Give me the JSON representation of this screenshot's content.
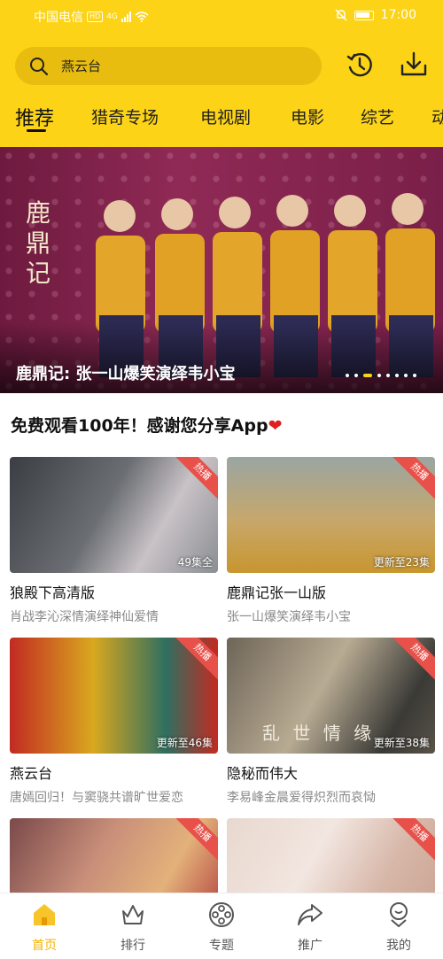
{
  "status_bar": {
    "carrier": "中国电信",
    "network_badge": "HD",
    "network_type": "4G",
    "time": "17:00"
  },
  "search": {
    "value": "燕云台",
    "icon": "search-icon"
  },
  "header_actions": [
    {
      "icon": "history-icon"
    },
    {
      "icon": "download-icon"
    }
  ],
  "tabs": [
    {
      "label": "推荐",
      "active": true
    },
    {
      "label": "猎奇专场"
    },
    {
      "label": "电视剧"
    },
    {
      "label": "电影"
    },
    {
      "label": "综艺"
    },
    {
      "label": "动"
    }
  ],
  "banner": {
    "title": "鹿鼎记: 张一山爆笑演绎韦小宝",
    "logo_text": "鹿鼎记",
    "slide_count": 9,
    "active_slide": 3
  },
  "section": {
    "title": "免费观看100年！感谢您分享App",
    "emoji": "❤"
  },
  "cards": [
    {
      "title": "狼殿下高清版",
      "subtitle": "肖战李沁深情演绎神仙爱情",
      "badge": "热播",
      "episodes": "49集全"
    },
    {
      "title": "鹿鼎记张一山版",
      "subtitle": "张一山爆笑演绎韦小宝",
      "badge": "热播",
      "episodes": "更新至23集"
    },
    {
      "title": "燕云台",
      "subtitle": "唐嫣回归！与窦骁共谱旷世爱恋",
      "badge": "热播",
      "episodes": "更新至46集"
    },
    {
      "title": "隐秘而伟大",
      "subtitle": "李易峰金晨爱得炽烈而哀恸",
      "badge": "热播",
      "episodes": "更新至38集",
      "overlay_text": "乱 世 情 缘"
    },
    {
      "title": "",
      "subtitle": "",
      "badge": "热播",
      "episodes": ""
    },
    {
      "title": "",
      "subtitle": "",
      "badge": "热播",
      "episodes": ""
    }
  ],
  "bottom_nav": [
    {
      "label": "首页",
      "icon": "home-icon",
      "active": true
    },
    {
      "label": "排行",
      "icon": "ranking-icon"
    },
    {
      "label": "专题",
      "icon": "film-reel-icon"
    },
    {
      "label": "推广",
      "icon": "share-icon"
    },
    {
      "label": "我的",
      "icon": "profile-icon"
    }
  ],
  "colors": {
    "brand_yellow": "#fcd316",
    "badge_red": "#e8504a",
    "active_nav": "#f2b400"
  }
}
